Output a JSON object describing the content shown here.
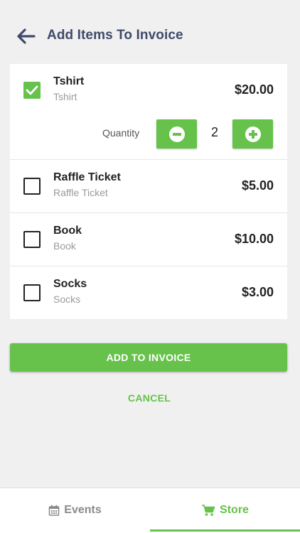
{
  "header": {
    "title": "Add Items To Invoice",
    "back_icon": "arrow-left-icon"
  },
  "colors": {
    "accent": "#66c24a",
    "title": "#3f4a6b"
  },
  "items": [
    {
      "name": "Tshirt",
      "sub": "Tshirt",
      "price": "$20.00",
      "checked": true
    },
    {
      "name": "Raffle Ticket",
      "sub": "Raffle Ticket",
      "price": "$5.00",
      "checked": false
    },
    {
      "name": "Book",
      "sub": "Book",
      "price": "$10.00",
      "checked": false
    },
    {
      "name": "Socks",
      "sub": "Socks",
      "price": "$3.00",
      "checked": false
    }
  ],
  "quantity": {
    "label": "Quantity",
    "value": "2"
  },
  "actions": {
    "add_label": "ADD TO INVOICE",
    "cancel_label": "CANCEL"
  },
  "nav": {
    "events_label": "Events",
    "store_label": "Store",
    "active": "Store"
  }
}
